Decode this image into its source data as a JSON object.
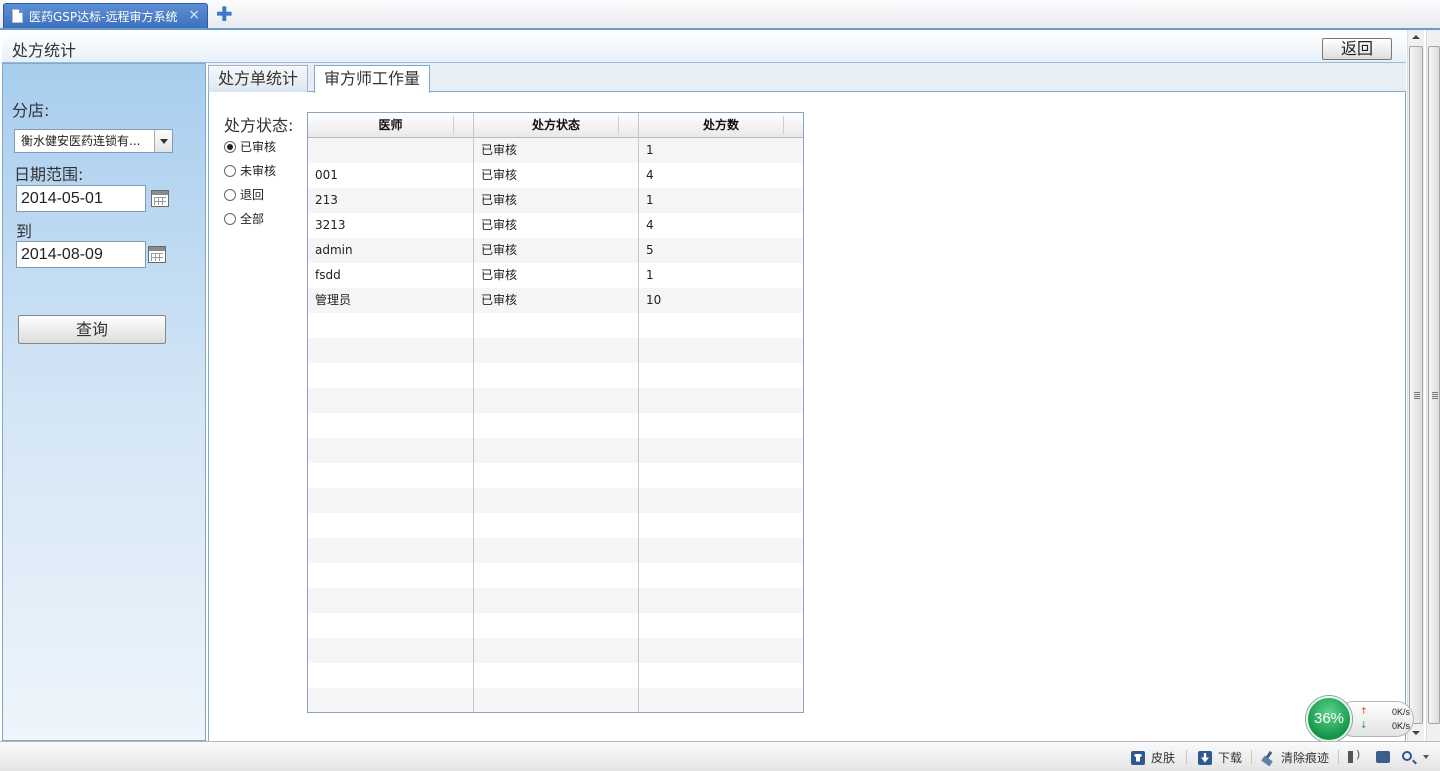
{
  "browser": {
    "tab_title": "医药GSP达标-远程审方系统",
    "tab_close": "×",
    "new_tab": "✚"
  },
  "header": {
    "title": "处方统计",
    "back_label": "返回"
  },
  "sidebar": {
    "store_label": "分店:",
    "store_value": "衡水健安医药连锁有...",
    "date_range_label": "日期范围:",
    "date_from": "2014-05-01",
    "to_label": "到",
    "date_to": "2014-08-09",
    "query_label": "查询"
  },
  "tabs": [
    {
      "label": "处方单统计",
      "active": false
    },
    {
      "label": "审方师工作量",
      "active": true
    }
  ],
  "filter": {
    "title": "处方状态:",
    "options": [
      {
        "label": "已审核",
        "checked": true
      },
      {
        "label": "未审核",
        "checked": false
      },
      {
        "label": "退回",
        "checked": false
      },
      {
        "label": "全部",
        "checked": false
      }
    ]
  },
  "grid": {
    "columns": [
      "医师",
      "处方状态",
      "处方数"
    ],
    "rows": [
      [
        "",
        "已审核",
        "1"
      ],
      [
        "001",
        "已审核",
        "4"
      ],
      [
        "213",
        "已审核",
        "1"
      ],
      [
        "3213",
        "已审核",
        "4"
      ],
      [
        "admin",
        "已审核",
        "5"
      ],
      [
        "fsdd",
        "已审核",
        "1"
      ],
      [
        "管理员",
        "已审核",
        "10"
      ]
    ],
    "empty_rows": 16
  },
  "speed_widget": {
    "percent": "36%",
    "upload": "0K/s",
    "download": "0K/s",
    "up_arrow": "↑",
    "down_arrow": "↓"
  },
  "statusbar": {
    "skin_label": "皮肤",
    "download_label": "下载",
    "clear_label": "清除痕迹"
  }
}
